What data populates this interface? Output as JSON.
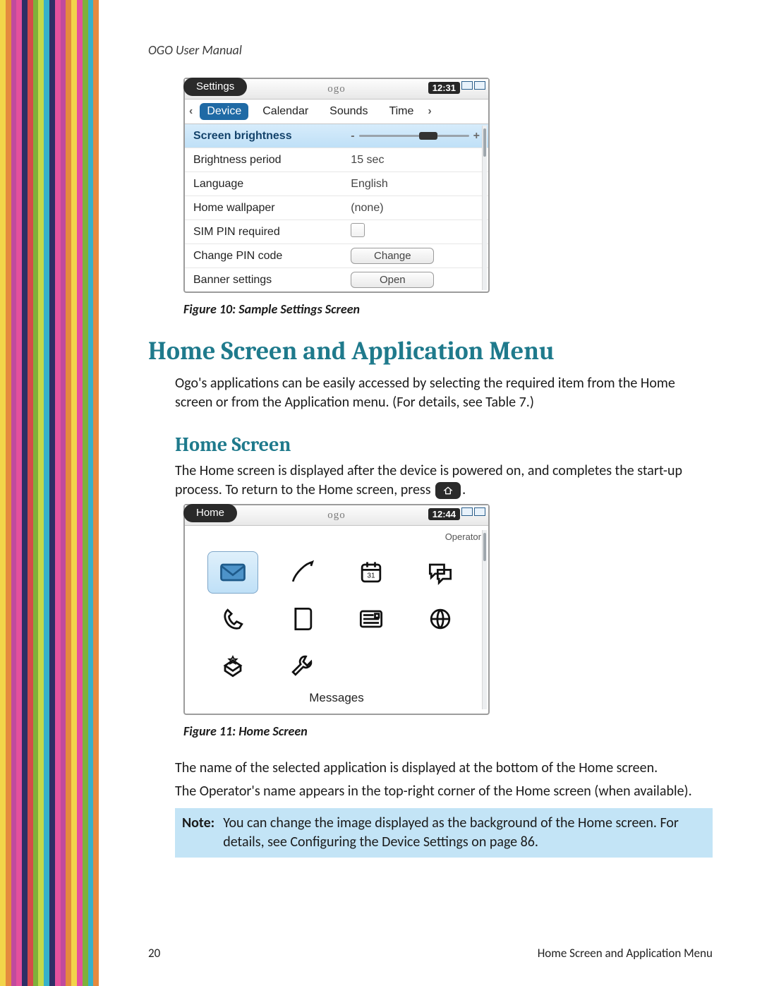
{
  "running_header": "OGO User Manual",
  "stripes": [
    "#f2d44a",
    "#e58a3e",
    "#c14a9e",
    "#e4519d",
    "#2e2e66",
    "#d44a4a",
    "#7fb03a",
    "#c2d94a",
    "#36b1c9",
    "#2e2e66",
    "#e4519d",
    "#c14a9e",
    "#e58a3e",
    "#f2d44a",
    "#e4519d",
    "#7fb03a",
    "#36b1c9",
    "#e58a3e"
  ],
  "figure10": {
    "caption": "Figure 10: Sample Settings Screen",
    "topbar_title": "Settings",
    "logo": "ogo",
    "clock": "12:31",
    "tabs": [
      "Device",
      "Calendar",
      "Sounds",
      "Time"
    ],
    "active_tab": "Device",
    "rows": [
      {
        "label": "Screen brightness",
        "type": "slider"
      },
      {
        "label": "Brightness period",
        "type": "text",
        "value": "15 sec"
      },
      {
        "label": "Language",
        "type": "text",
        "value": "English"
      },
      {
        "label": "Home wallpaper",
        "type": "text",
        "value": "(none)"
      },
      {
        "label": "SIM PIN required",
        "type": "checkbox"
      },
      {
        "label": "Change PIN code",
        "type": "button",
        "value": "Change"
      },
      {
        "label": "Banner settings",
        "type": "button",
        "value": "Open"
      }
    ]
  },
  "h1": "Home Screen and Application Menu",
  "intro_paragraph": "Ogo's applications can be easily accessed by selecting the required item from the Home screen or from the Application menu. (For details, see Table 7.)",
  "h2": "Home Screen",
  "home_paragraph_before_key": "The Home screen is displayed after the device is powered on, and completes the start-up process. To return to the Home screen, press ",
  "home_paragraph_after_key": ".",
  "figure11": {
    "caption": "Figure 11: Home Screen",
    "topbar_title": "Home",
    "logo": "ogo",
    "clock": "12:44",
    "operator": "Operator",
    "selected_app_name": "Messages",
    "icons": [
      "mail",
      "pen",
      "calendar",
      "chat",
      "phone",
      "book",
      "news",
      "globe",
      "box",
      "wrench"
    ]
  },
  "para_after_fig11_a": "The name of the selected application is displayed at the bottom of the Home screen.",
  "para_after_fig11_b": "The Operator's name appears in the top-right corner of the Home screen (when available).",
  "note_label": "Note:",
  "note_text": "You can change the image displayed as the background of the Home screen. For details, see Configuring the Device Settings on page 86.",
  "footer_page": "20",
  "footer_section": "Home Screen and Application Menu"
}
